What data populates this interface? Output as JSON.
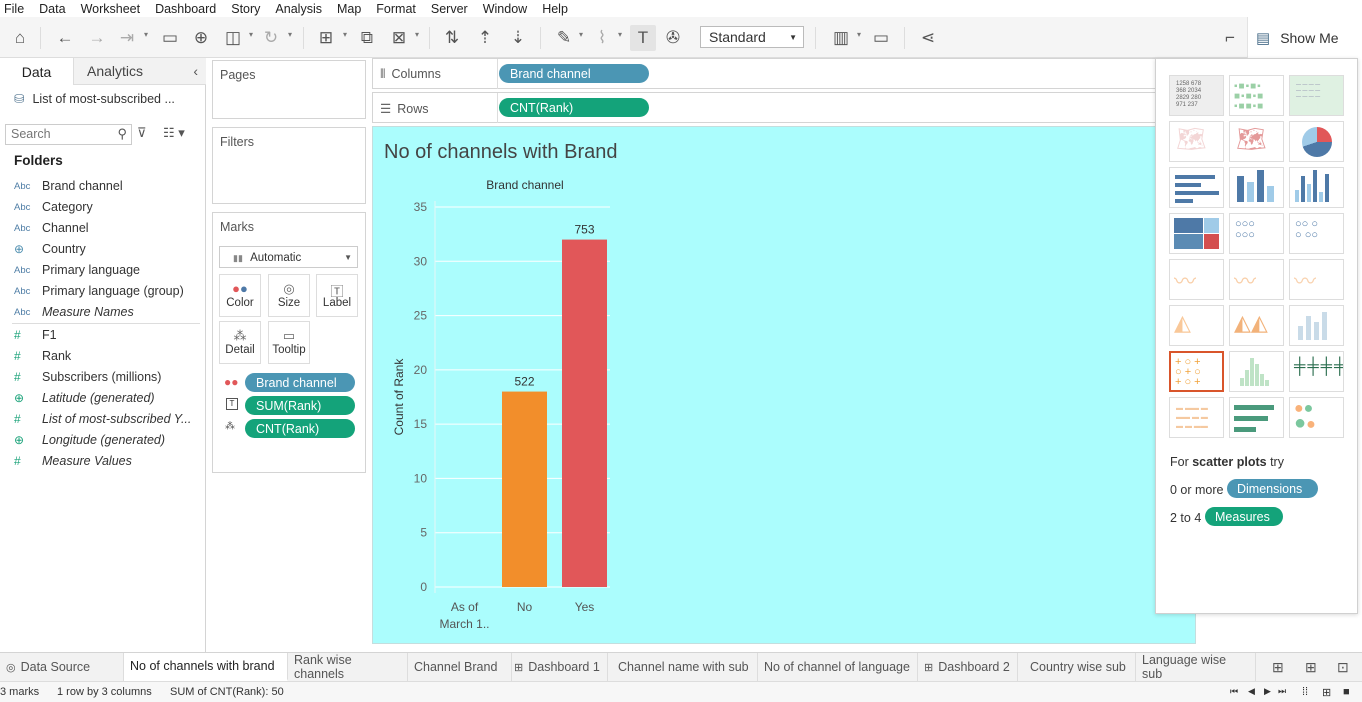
{
  "menu": [
    "File",
    "Data",
    "Worksheet",
    "Dashboard",
    "Story",
    "Analysis",
    "Map",
    "Format",
    "Server",
    "Window",
    "Help"
  ],
  "toolbar": {
    "fit": "Standard",
    "show_me": "Show Me"
  },
  "left_pane": {
    "tab_data": "Data",
    "tab_analytics": "Analytics",
    "datasource": "List of most-subscribed ...",
    "search_placeholder": "Search",
    "folders_title": "Folders",
    "dimension_icon": "Abc",
    "dimensions": [
      "Brand channel",
      "Category",
      "Channel",
      "Country",
      "Primary language",
      "Primary language (group)",
      "Measure Names"
    ],
    "measures": [
      "F1",
      "Rank",
      "Subscribers (millions)",
      "Latitude (generated)",
      "List of most-subscribed Y...",
      "Longitude (generated)",
      "Measure Values"
    ]
  },
  "cards": {
    "pages": "Pages",
    "filters": "Filters",
    "marks": "Marks",
    "mark_type": "Automatic",
    "mark_buttons": [
      "Color",
      "Size",
      "Label",
      "Detail",
      "Tooltip"
    ],
    "mark_pills": [
      "Brand channel",
      "SUM(Rank)",
      "CNT(Rank)"
    ]
  },
  "shelves": {
    "columns_label": "Columns",
    "columns_pill": "Brand channel",
    "rows_label": "Rows",
    "rows_pill": "CNT(Rank)"
  },
  "chart_data": {
    "type": "bar",
    "title": "No of channels with Brand",
    "header": "Brand channel",
    "categories": [
      "As of March 1..",
      "No",
      "Yes"
    ],
    "values": [
      0,
      18,
      32
    ],
    "data_labels": [
      "",
      "522",
      "753"
    ],
    "colors": [
      "#4e79a7",
      "#f28e2b",
      "#e15759"
    ],
    "ylabel": "Count of Rank",
    "yticks": [
      0,
      5,
      10,
      15,
      20,
      25,
      30,
      35
    ],
    "ylim": [
      0,
      35
    ]
  },
  "show_me": {
    "hint_prefix": "For",
    "hint_bold": "scatter plots",
    "hint_suffix": "try",
    "dim_prefix": "0 or more",
    "dim_pill": "Dimensions",
    "meas_prefix": "2 to 4",
    "meas_pill": "Measures"
  },
  "tabs": [
    "Data Source",
    "No of channels with brand",
    "Rank wise channels",
    "Channel Brand",
    "Dashboard 1",
    "Channel name with sub",
    "No of channel of language",
    "Dashboard 2",
    "Country wise sub",
    "Language wise sub"
  ],
  "status": {
    "marks": "3 marks",
    "rows_cols": "1 row by 3 columns",
    "sum": "SUM of CNT(Rank): 50"
  }
}
